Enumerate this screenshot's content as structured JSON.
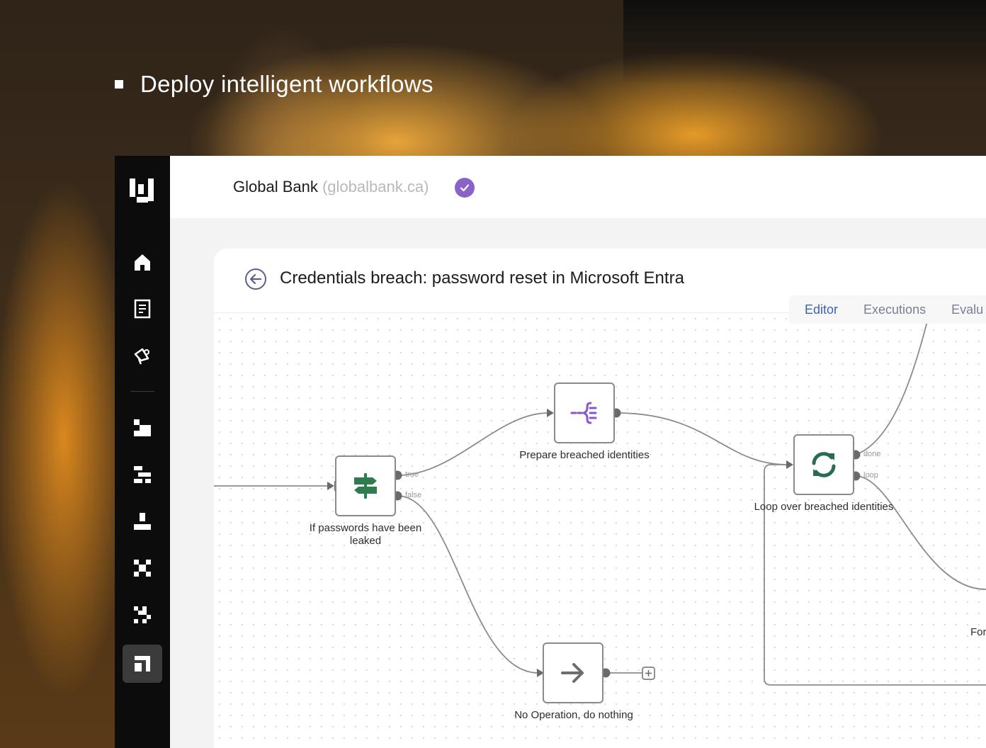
{
  "tagline": "Deploy intelligent workflows",
  "header": {
    "org_name": "Global Bank",
    "org_domain": "(globalbank.ca)"
  },
  "workflow": {
    "title": "Credentials breach: password reset in Microsoft Entra",
    "tabs": [
      {
        "label": "Editor",
        "active": true
      },
      {
        "label": "Executions",
        "active": false
      },
      {
        "label": "Evalu",
        "active": false
      }
    ],
    "nodes": [
      {
        "label": "If passwords have been leaked",
        "icon": "signpost-icon",
        "color": "#2f7d4f"
      },
      {
        "label": "Prepare breached identities",
        "icon": "code-brackets-icon",
        "color": "#8a55c9"
      },
      {
        "label": "Loop over breached identities",
        "icon": "refresh-loop-icon",
        "color": "#2b6b55"
      },
      {
        "label": "No Operation, do nothing",
        "icon": "arrow-right-icon",
        "color": "#6d6d6d"
      }
    ],
    "ports": {
      "true": "true",
      "false": "false",
      "done": "done",
      "loop": "loop"
    },
    "cut_node_label": "For"
  },
  "colors": {
    "accent_purple": "#8a63c8",
    "tab_active": "#3b62b3",
    "sidebar_bg": "#0c0c0c"
  }
}
